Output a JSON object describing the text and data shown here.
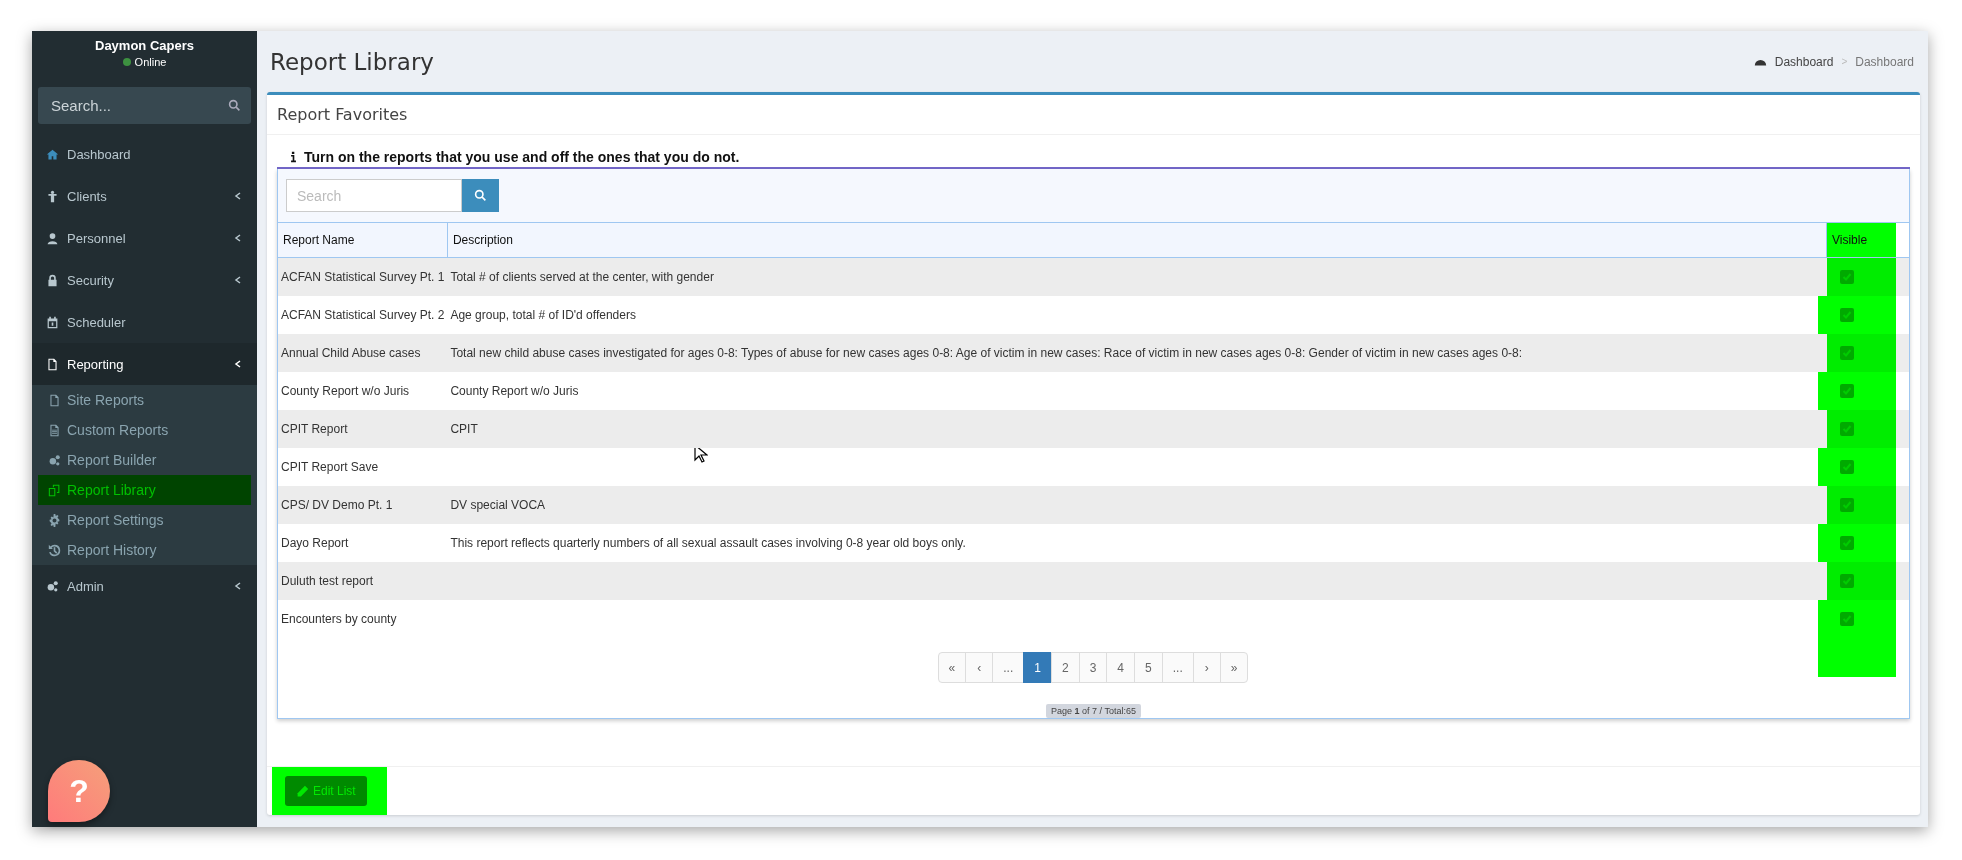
{
  "sidebar": {
    "user": {
      "name": "Daymon Capers",
      "status": "Online"
    },
    "search": {
      "placeholder": "Search..."
    },
    "menu": [
      {
        "label": "Dashboard",
        "has_submenu": false,
        "expanded": false
      },
      {
        "label": "Clients",
        "has_submenu": true,
        "expanded": false
      },
      {
        "label": "Personnel",
        "has_submenu": true,
        "expanded": false
      },
      {
        "label": "Security",
        "has_submenu": true,
        "expanded": false
      },
      {
        "label": "Scheduler",
        "has_submenu": false,
        "expanded": false
      },
      {
        "label": "Reporting",
        "has_submenu": true,
        "expanded": true,
        "children": [
          {
            "label": "Site Reports",
            "selected": false
          },
          {
            "label": "Custom Reports",
            "selected": false
          },
          {
            "label": "Report Builder",
            "selected": false
          },
          {
            "label": "Report Library",
            "selected": true
          },
          {
            "label": "Report Settings",
            "selected": false
          },
          {
            "label": "Report History",
            "selected": false
          }
        ]
      },
      {
        "label": "Admin",
        "has_submenu": true,
        "expanded": false
      }
    ]
  },
  "header": {
    "title": "Report Library",
    "breadcrumb": [
      "Dashboard",
      "Dashboard"
    ],
    "breadcrumb_separator": ">"
  },
  "box": {
    "title": "Report Favorites",
    "info": "Turn on the reports that you use and off the ones that you do not.",
    "table": {
      "search": {
        "placeholder": "Search"
      },
      "columns": [
        "Report Name",
        "Description",
        "Visible"
      ],
      "rows": [
        {
          "name": "ACFAN Statistical Survey Pt. 1",
          "description": "Total # of clients served at the center, with gender",
          "visible": true
        },
        {
          "name": "ACFAN Statistical Survey Pt. 2",
          "description": "Age group, total # of ID'd offenders",
          "visible": true
        },
        {
          "name": "Annual Child Abuse cases",
          "description": "Total new child abuse cases investigated for ages 0-8: Types of abuse for new cases ages 0-8: Age of victim in new cases: Race of victim in new cases ages 0-8: Gender of victim in new cases ages 0-8:",
          "visible": true
        },
        {
          "name": "County Report w/o Juris",
          "description": "County Report w/o Juris",
          "visible": true
        },
        {
          "name": "CPIT Report",
          "description": "CPIT",
          "visible": true
        },
        {
          "name": "CPIT Report Save",
          "visible": true
        },
        {
          "name": "CPS/ DV Demo Pt. 1",
          "description": "DV special VOCA",
          "visible": true
        },
        {
          "name": "Dayo Report",
          "description": "This report reflects quarterly numbers of all sexual assault cases involving 0-8 year old boys only.",
          "visible": true
        },
        {
          "name": "Duluth test report",
          "visible": true
        },
        {
          "name": "Encounters by county",
          "visible": true
        }
      ],
      "pagination": [
        {
          "label": "«",
          "selected": false
        },
        {
          "label": "‹",
          "selected": false
        },
        {
          "label": "...",
          "selected": false
        },
        {
          "label": "1",
          "selected": true
        },
        {
          "label": "2",
          "selected": false
        },
        {
          "label": "3",
          "selected": false
        },
        {
          "label": "4",
          "selected": false
        },
        {
          "label": "5",
          "selected": false
        },
        {
          "label": "...",
          "selected": false
        },
        {
          "label": "›",
          "selected": false
        },
        {
          "label": "»",
          "selected": false
        }
      ],
      "summary": "Page **1** of 7 / Total:65"
    },
    "footer_button": "Edit List"
  },
  "help_button": "?"
}
